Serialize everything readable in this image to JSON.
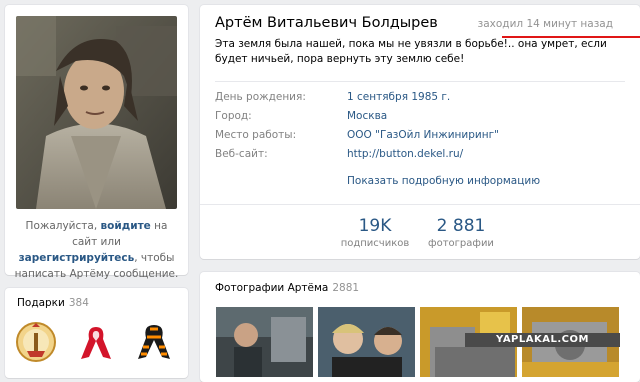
{
  "profile": {
    "name": "Артём Витальевич Болдырев",
    "last_seen": "заходил 14 минут назад",
    "status": "Эта земля была нашей, пока мы не увязли в борьбе!.. она умрет, если будет ничьей, пора вернуть эту землю себе!",
    "info": [
      {
        "label": "День рождения:",
        "value": "1 сентября 1985 г."
      },
      {
        "label": "Город:",
        "value": "Москва"
      },
      {
        "label": "Место работы:",
        "value": "ООО \"ГазОйл Инжиниринг\""
      },
      {
        "label": "Веб-сайт:",
        "value": "http://button.dekel.ru/"
      }
    ],
    "more_link": "Показать подробную информацию",
    "counters": [
      {
        "num": "19K",
        "label": "подписчиков"
      },
      {
        "num": "2 881",
        "label": "фотографии"
      }
    ]
  },
  "login_note": {
    "text1": "Пожалуйста,",
    "link1": "войдите",
    "text2": "на сайт или",
    "link2": "зарегистрируйтесь",
    "text3": ", чтобы написать Артёму сообщение."
  },
  "gifts": {
    "title": "Подарки",
    "count": "384"
  },
  "photos": {
    "title": "Фотографии Артёма",
    "count": "2881"
  },
  "watermark": "YAPLAKAL.COM",
  "colors": {
    "link": "#2a5885",
    "muted": "#828282",
    "accent_underline": "#e01616",
    "background": "#edeef0"
  }
}
